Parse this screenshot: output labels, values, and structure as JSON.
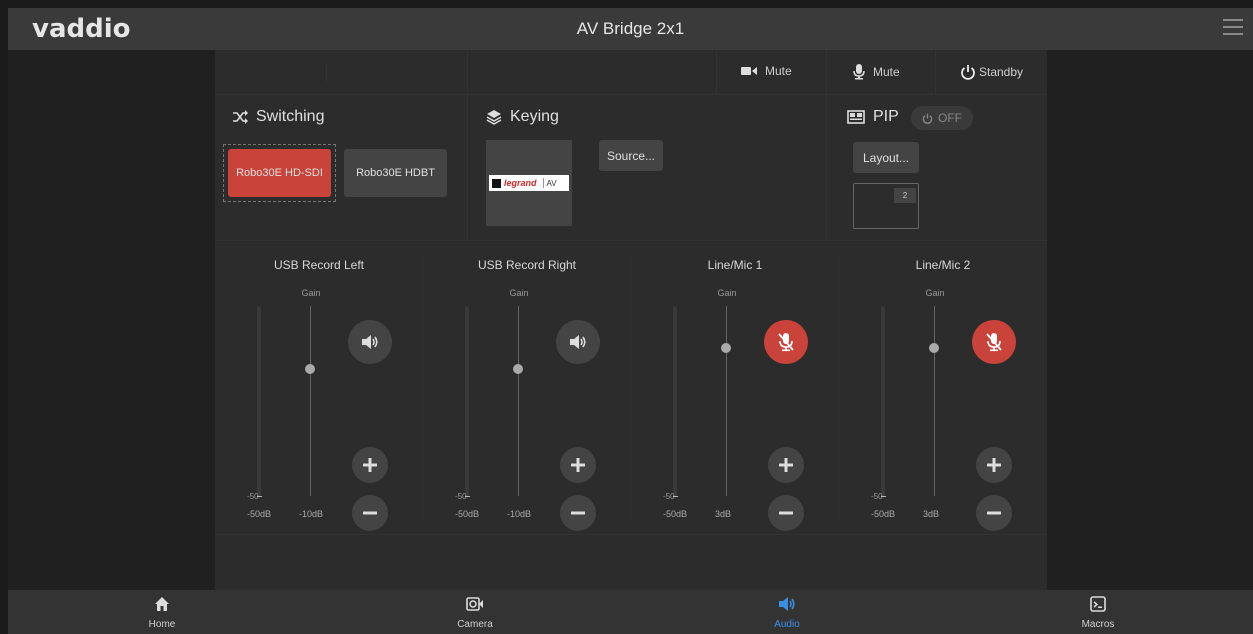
{
  "header": {
    "logo": "vaddio",
    "title": "AV Bridge 2x1"
  },
  "status": {
    "video_mute": "Mute",
    "audio_mute": "Mute",
    "standby": "Standby"
  },
  "switching": {
    "title": "Switching",
    "sources": [
      "Robo30E HD-SDI",
      "Robo30E HDBT"
    ],
    "selected": "Robo30E HD-SDI"
  },
  "keying": {
    "title": "Keying",
    "source_button": "Source...",
    "logo_text": "legrand",
    "logo_suffix": "AV"
  },
  "pip": {
    "title": "PIP",
    "state": "OFF",
    "layout_button": "Layout...",
    "preview_number": "2"
  },
  "audio": {
    "gain_label": "Gain",
    "scale_min_tick": "-50",
    "channels": [
      {
        "name": "USB Record Left",
        "meter_label": "-50dB",
        "gain_value": "-10dB",
        "gain_level": 0.67,
        "muted": false
      },
      {
        "name": "USB Record Right",
        "meter_label": "-50dB",
        "gain_value": "-10dB",
        "gain_level": 0.67,
        "muted": false
      },
      {
        "name": "Line/Mic 1",
        "meter_label": "-50dB",
        "gain_value": "3dB",
        "gain_level": 0.78,
        "muted": true
      },
      {
        "name": "Line/Mic 2",
        "meter_label": "-50dB",
        "gain_value": "3dB",
        "gain_level": 0.78,
        "muted": true
      }
    ]
  },
  "nav": {
    "items": [
      {
        "label": "Home",
        "icon": "home-icon"
      },
      {
        "label": "Camera",
        "icon": "camera-icon"
      },
      {
        "label": "Audio",
        "icon": "speaker-icon"
      },
      {
        "label": "Macros",
        "icon": "terminal-icon"
      }
    ],
    "active": "Audio",
    "accent": "#3b8fe3"
  },
  "colors": {
    "mute_red": "#c9433a",
    "selected_red": "#c9433a"
  }
}
